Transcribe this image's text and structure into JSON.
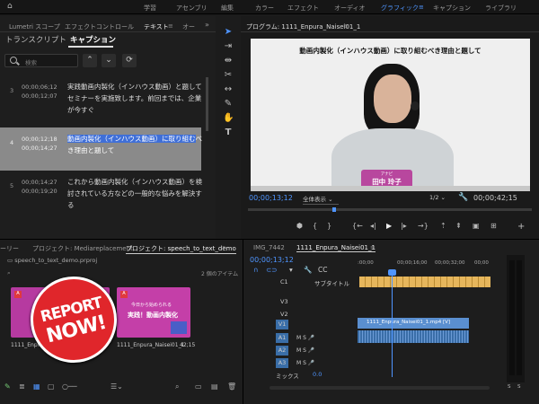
{
  "workspaces": {
    "items": [
      "学習",
      "アセンブリ",
      "編集",
      "カラー",
      "エフェクト",
      "オーディオ",
      "グラフィック",
      "キャプション",
      "ライブラリ"
    ],
    "active": "グラフィック"
  },
  "left_panel": {
    "tabs": [
      "Lumetri スコープ",
      "エフェクトコントロール",
      "テキスト",
      "オー"
    ],
    "subtabs": [
      "トランスクリプト",
      "キャプション"
    ],
    "search_placeholder": "検索",
    "captions": [
      {
        "num": "3",
        "start": "00;00;06;12",
        "end": "00;00;12;07",
        "text": "実践動画内製化（インハウス動画）と題してセミナーを実施致します。前回までは、企業が今すぐ"
      },
      {
        "num": "4",
        "start": "00;00;12;18",
        "end": "00;00;14;27",
        "text_highlight": "動画内製化（インハウス動画）に取り組む",
        "text_rest": "べき理由と題して"
      },
      {
        "num": "5",
        "start": "00;00;14;27",
        "end": "00;00;19;20",
        "text": "これから動画内製化（インハウス動画）を検討されている方などの一般的な悩みを解決する"
      }
    ]
  },
  "program": {
    "tab": "プログラム: 1111_Enpura_Naisei01_1",
    "caption": "動画内製化（インハウス動画）に取り組むべき理由と題して",
    "nameplate_small": "アナビ",
    "nameplate_name": "田中 玲子",
    "timecode": "00;00;13;12",
    "fit": "全体表示",
    "ratio": "1/2",
    "duration": "00;00;42;15"
  },
  "project": {
    "tabs": [
      "ーリー",
      "プロジェクト: Mediareplacement",
      "プロジェクト: speech_to_text_demo"
    ],
    "file": "speech_to_text_demo.prproj",
    "items_count": "2 個のアイテム",
    "clip1": "1111_Enpura_Naisei01_1",
    "clip2_name": "1111_Enpura_Naisei01_1",
    "clip2_dur": "42;15",
    "thumb_text1": "今日から始められる",
    "thumb_text2": "実践！動画内製化",
    "badge_line1": "REPORT",
    "badge_line2": "NOW!"
  },
  "timeline": {
    "tabs": [
      "IMG_7442",
      "1111_Enpura_Naisei01_1"
    ],
    "timecode": "00;00;13;12",
    "ruler": [
      ":00;00",
      "00;00;16;00",
      "00;00;32;00",
      "00;00"
    ],
    "subtitle_label": "サブタイトル",
    "tracks": [
      "C1",
      "V3",
      "V2",
      "V1",
      "A1",
      "A2",
      "A3"
    ],
    "video_clip": "1111_Enpura_Naisei01_1.mp4 [V]",
    "mix_label": "ミックス",
    "mix_value": "0.0",
    "meter_labels": [
      "S",
      "S"
    ]
  },
  "colors": {
    "accent": "#4f95ff",
    "caption_highlight": "#8a8a8a",
    "nameplate": "#b8479e",
    "badge": "#e0262b",
    "clip_video": "#5a8fd0",
    "clip_audio": "#3a6ea8",
    "subtitle_clips": "#e6b65c"
  }
}
